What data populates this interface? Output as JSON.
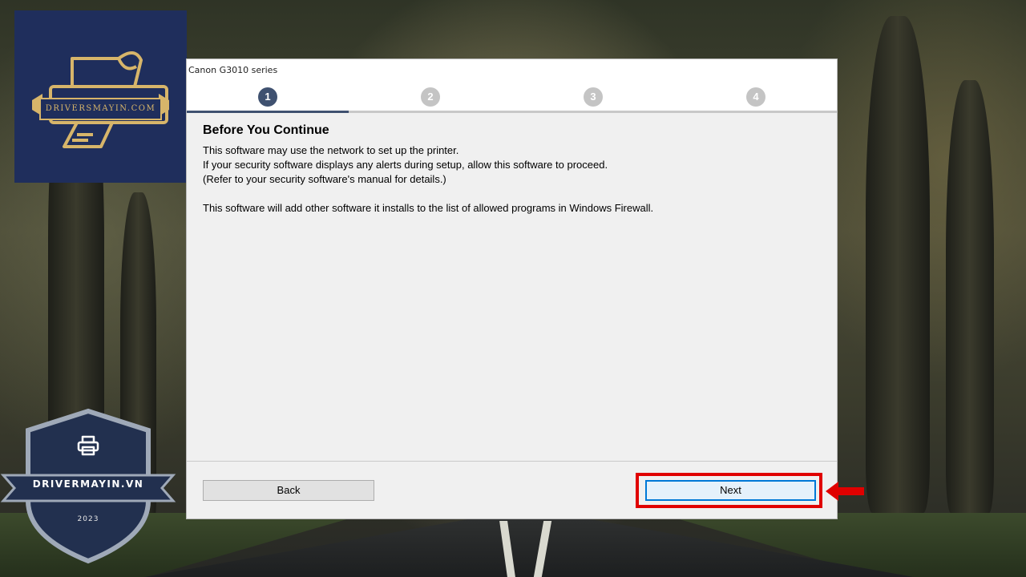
{
  "window": {
    "title": "Canon G3010 series"
  },
  "steps": [
    {
      "label": "1",
      "active": true
    },
    {
      "label": "2",
      "active": false
    },
    {
      "label": "3",
      "active": false
    },
    {
      "label": "4",
      "active": false
    }
  ],
  "content": {
    "heading": "Before You Continue",
    "lines": [
      "This software may use the network to set up the printer.",
      "If your security software displays any alerts during setup, allow this software to proceed.",
      "(Refer to your security software's manual for details.)"
    ],
    "note": "This software will add other software it installs to the list of allowed programs in Windows Firewall."
  },
  "buttons": {
    "back": "Back",
    "next": "Next"
  },
  "logo": {
    "text": "DRIVERSMAYIN.COM"
  },
  "badge": {
    "name": "DRIVERMAYIN.VN",
    "year": "2023"
  },
  "colors": {
    "step_active": "#3f5170",
    "step_inactive": "#c4c4c4",
    "highlight": "#e00000",
    "logo_bg": "#1f2e5c",
    "logo_gold": "#d7b56a"
  },
  "icons": [
    "printer-logo-icon",
    "printer-icon",
    "arrow-left-icon"
  ]
}
